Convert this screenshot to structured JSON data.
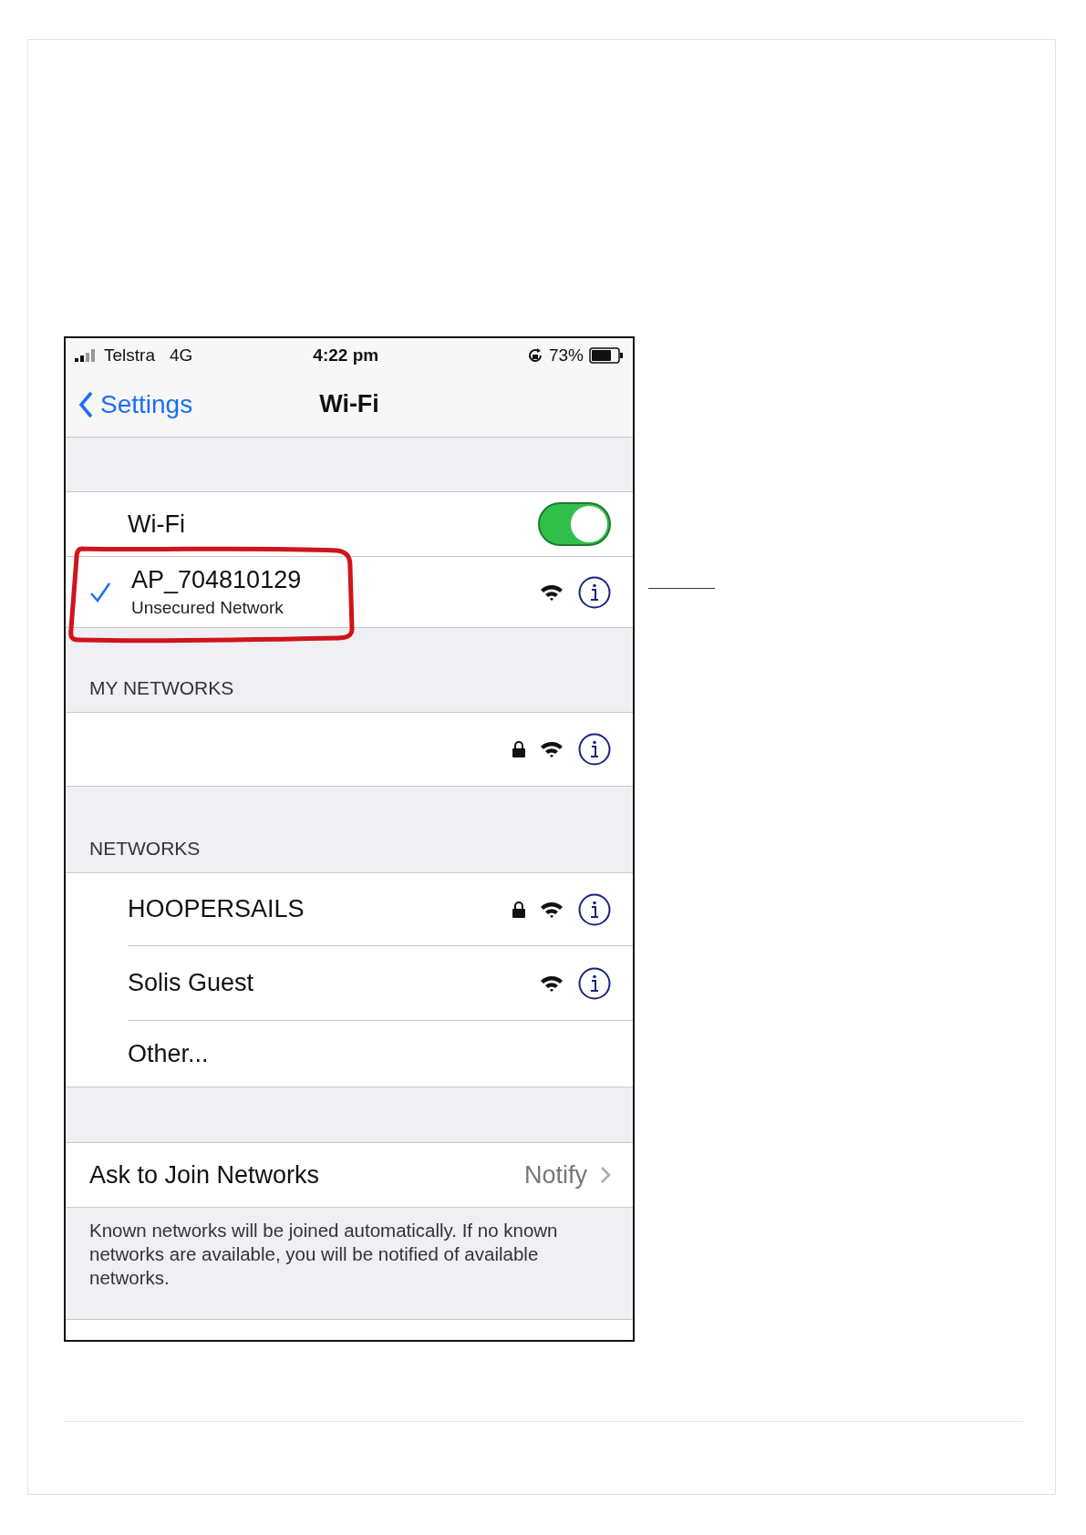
{
  "status_bar": {
    "carrier": "Telstra",
    "network": "4G",
    "time": "4:22 pm",
    "battery": "73%"
  },
  "nav": {
    "back": "Settings",
    "title": "Wi-Fi"
  },
  "wifi": {
    "label": "Wi-Fi",
    "on": true
  },
  "connected": {
    "name": "AP_704810129",
    "subtitle": "Unsecured Network",
    "connected": true,
    "secured": false
  },
  "my_networks": {
    "header": "MY NETWORKS",
    "items": [
      {
        "kind": "network",
        "secured": true
      }
    ]
  },
  "networks": {
    "header": "NETWORKS",
    "items": [
      {
        "kind": "network",
        "name": "HOOPERSAILS",
        "secured": true
      },
      {
        "kind": "network",
        "name": "Solis Guest",
        "secured": false
      },
      {
        "kind": "other",
        "name": "Other..."
      }
    ]
  },
  "ask_to_join": {
    "label": "Ask to Join Networks",
    "value": "Notify"
  },
  "footer": "Known networks will be joined automatically. If no known networks are available, you will be notified of available networks."
}
